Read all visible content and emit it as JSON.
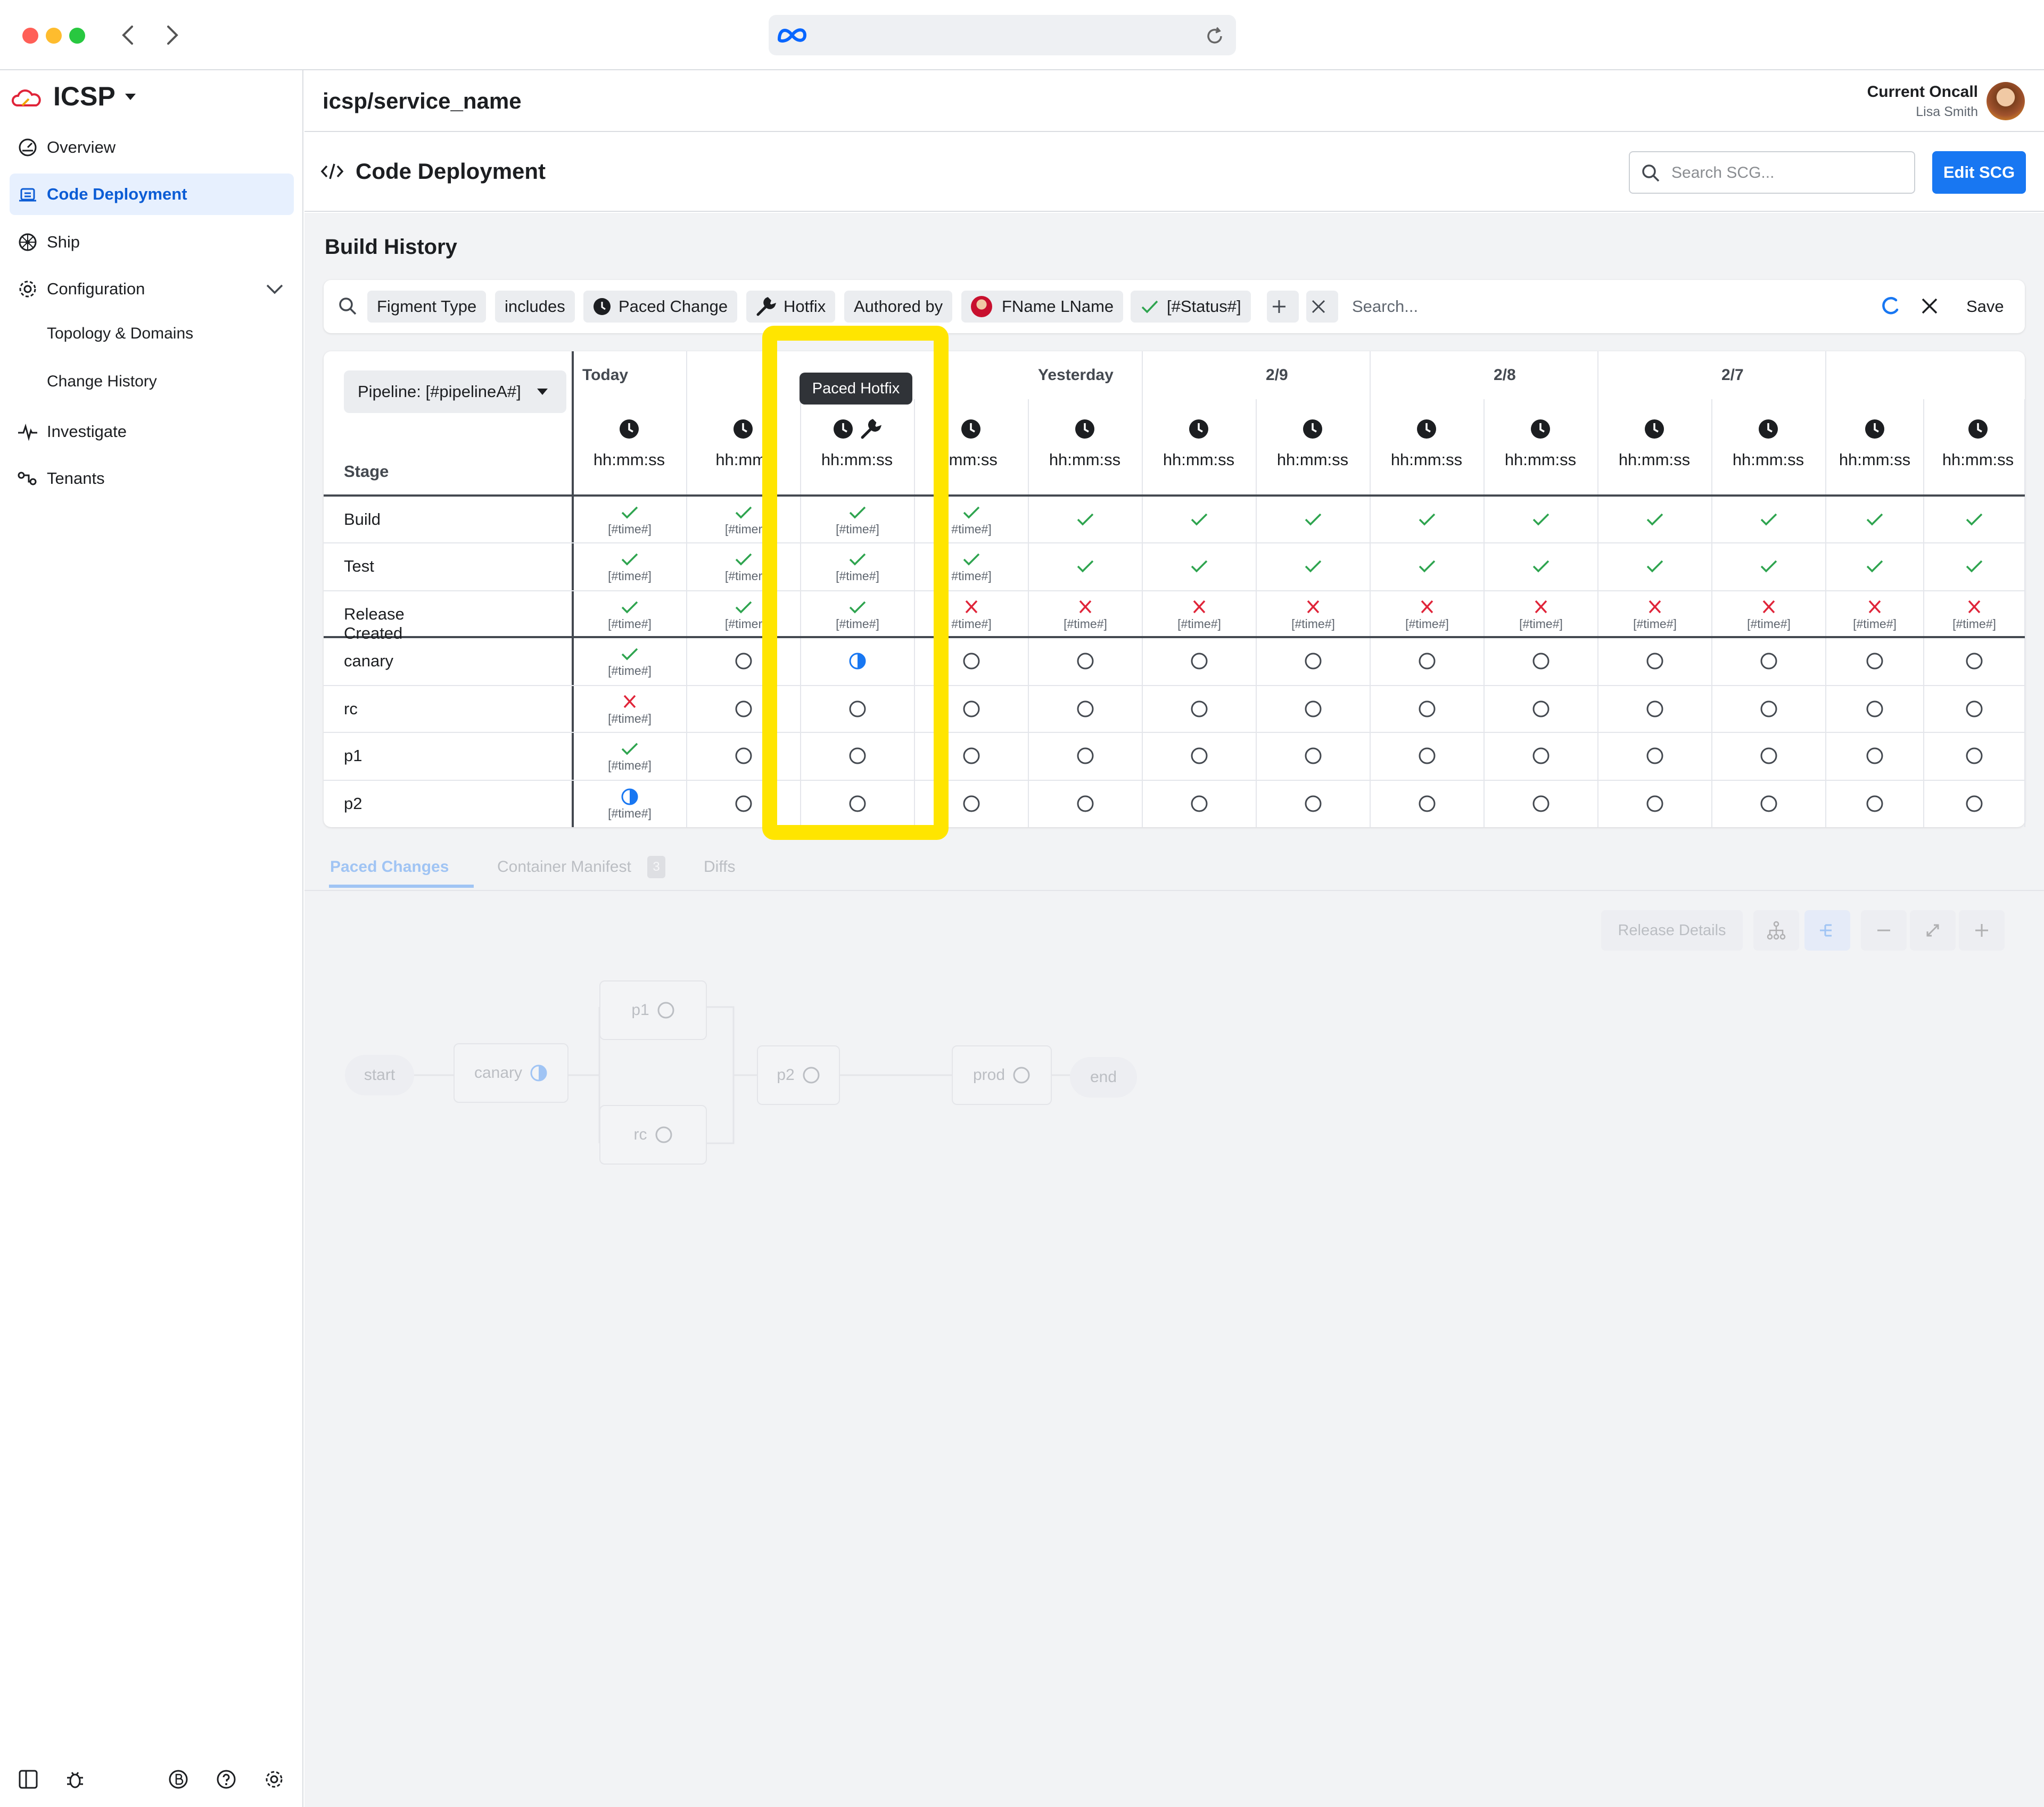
{
  "app": {
    "name": "ICSP",
    "service": "icsp/service_name"
  },
  "oncall": {
    "label": "Current Oncall",
    "name": "Lisa Smith"
  },
  "sidebar": {
    "items": [
      {
        "label": "Overview",
        "icon": "dashboard-icon"
      },
      {
        "label": "Code Deployment",
        "icon": "deploy-icon"
      },
      {
        "label": "Ship",
        "icon": "ship-wheel-icon"
      },
      {
        "label": "Configuration",
        "icon": "gear-icon"
      },
      {
        "label": "Topology & Domains"
      },
      {
        "label": "Change History"
      },
      {
        "label": "Investigate",
        "icon": "pulse-icon"
      },
      {
        "label": "Tenants",
        "icon": "tenants-icon"
      }
    ]
  },
  "page": {
    "title": "Code Deployment",
    "search_placeholder": "Search SCG...",
    "edit_label": "Edit SCG"
  },
  "build_history": {
    "title": "Build History"
  },
  "filters": {
    "chips": [
      "Figment Type",
      "includes",
      "Paced Change",
      "Hotfix",
      "Authored by",
      "FName LName",
      "[#Status#]"
    ],
    "search_placeholder": "Search...",
    "save_label": "Save"
  },
  "grid": {
    "pipeline_label": "Pipeline: [#pipelineA#]",
    "stage_header": "Stage",
    "date_groups": [
      "Today",
      "Yesterday",
      "2/9",
      "2/8",
      "2/7"
    ],
    "tooltip": "Paced Hotfix",
    "time_label": "hh:mm:ss",
    "time_placeholder": "[#time#]",
    "stages": [
      "Build",
      "Test",
      "Release Created",
      "canary",
      "rc",
      "p1",
      "p2"
    ],
    "visible_time_labels": [
      "hh:mm:ss",
      "hh:mm:",
      "hh:mm:ss",
      ":mm:ss",
      "hh:mm:ss",
      "hh:mm:ss",
      "hh:mm:ss",
      "hh:mm:ss",
      "hh:mm:ss",
      "hh:mm:ss",
      "hh:mm:ss",
      "hh:mm:ss",
      "hh:mm:ss"
    ],
    "visible_timestamps": [
      "[#time#]",
      "[#timer",
      "#time#]"
    ],
    "statuses": [
      [
        "check-ts",
        "check-ts",
        "check-ts",
        "check-ts",
        "check",
        "check",
        "check",
        "check",
        "check",
        "check",
        "check",
        "check",
        "check"
      ],
      [
        "check-ts",
        "check-ts",
        "check-ts",
        "check-ts",
        "check",
        "check",
        "check",
        "check",
        "check",
        "check",
        "check",
        "check",
        "check"
      ],
      [
        "check-ts",
        "check-ts",
        "check-ts",
        "x-ts",
        "x-ts",
        "x-ts",
        "x-ts",
        "x-ts",
        "x-ts",
        "x-ts",
        "x-ts",
        "x-ts",
        "x-ts"
      ],
      [
        "check-ts",
        "circle",
        "half",
        "circle",
        "circle",
        "circle",
        "circle",
        "circle",
        "circle",
        "circle",
        "circle",
        "circle",
        "circle"
      ],
      [
        "x-ts",
        "circle",
        "circle",
        "circle",
        "circle",
        "circle",
        "circle",
        "circle",
        "circle",
        "circle",
        "circle",
        "circle",
        "circle"
      ],
      [
        "check-ts",
        "circle",
        "circle",
        "circle",
        "circle",
        "circle",
        "circle",
        "circle",
        "circle",
        "circle",
        "circle",
        "circle",
        "circle"
      ],
      [
        "half-ts",
        "circle",
        "circle",
        "circle",
        "circle",
        "circle",
        "circle",
        "circle",
        "circle",
        "circle",
        "circle",
        "circle",
        "circle"
      ]
    ],
    "colors": {
      "check": "#2ea44f",
      "x": "#e02439",
      "half": "#1877f2",
      "circle": "#444950",
      "highlight": "#ffe500"
    }
  },
  "tabs": {
    "items": [
      "Paced Changes",
      "Container Manifest",
      "Diffs"
    ],
    "badge": "3"
  },
  "flow": {
    "release_details": "Release Details",
    "nodes": [
      "start",
      "canary",
      "p1",
      "rc",
      "p2",
      "prod",
      "end"
    ]
  }
}
